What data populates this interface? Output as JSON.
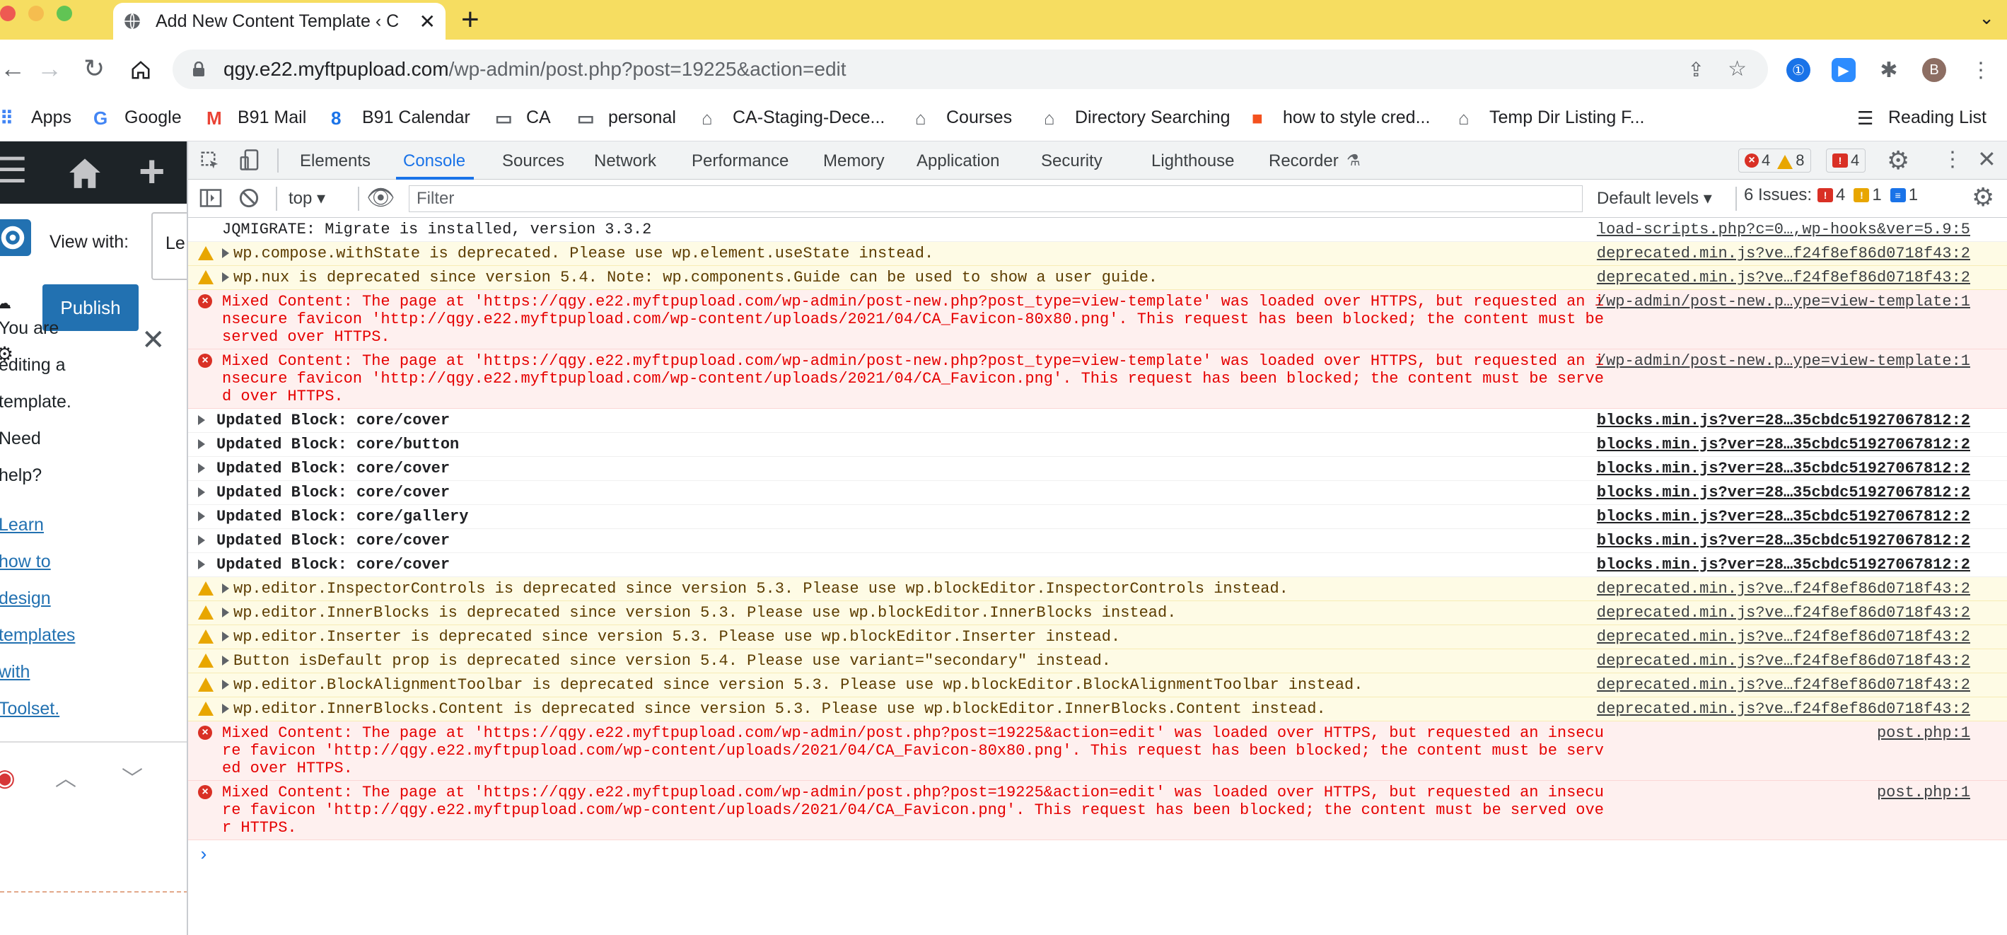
{
  "colors": {
    "tabstrip": "#f6dd61",
    "wp_blue": "#2271b1",
    "wp_dark": "#1d2327",
    "error": "#d93025",
    "warning": "#e8a600",
    "accent": "#1a73e8"
  },
  "browser": {
    "tab_title": "Add New Content Template ‹ C",
    "url_host": "qgy.e22.myftpupload.com",
    "url_path": "/wp-admin/post.php?post=19225&action=edit",
    "profile_initial": "B"
  },
  "bookmarks": [
    {
      "label": "Apps",
      "icon": "apps-grid-icon"
    },
    {
      "label": "Google",
      "icon": "google-icon"
    },
    {
      "label": "B91 Mail",
      "icon": "gmail-icon"
    },
    {
      "label": "B91 Calendar",
      "icon": "calendar-icon"
    },
    {
      "label": "CA",
      "icon": "folder-icon"
    },
    {
      "label": "personal",
      "icon": "folder-icon"
    },
    {
      "label": "CA-Staging-Dece...",
      "icon": "bell-icon"
    },
    {
      "label": "Courses",
      "icon": "bell-icon"
    },
    {
      "label": "Directory Searching",
      "icon": "bell-icon"
    },
    {
      "label": "how to style cred...",
      "icon": "orange-app-icon"
    },
    {
      "label": "Temp Dir Listing F...",
      "icon": "bell-icon"
    }
  ],
  "reading_list": "Reading List",
  "wp": {
    "view_with": "View with:",
    "select_value": "Le",
    "publish": "Publish",
    "lines": [
      "You are",
      "editing a",
      "template.",
      "Need",
      "help?"
    ],
    "links": [
      "Learn",
      "how to",
      "design",
      "templates",
      "with",
      "Toolset."
    ]
  },
  "devtools": {
    "tabs": [
      "Elements",
      "Console",
      "Sources",
      "Network",
      "Performance",
      "Memory",
      "Application",
      "Security",
      "Lighthouse",
      "Recorder"
    ],
    "active_tab": "Console",
    "badges": {
      "errors": "4",
      "warnings": "8",
      "issues": "4"
    },
    "context": "top",
    "filter_placeholder": "Filter",
    "levels": "Default levels",
    "issues_label": "6 Issues:",
    "issues_counts": {
      "errors": "4",
      "warnings": "1",
      "info": "1"
    },
    "prompt": "›"
  },
  "console": [
    {
      "level": "info",
      "msg": "JQMIGRATE: Migrate is installed, version 3.3.2",
      "src": "load-scripts.php?c=0…,wp-hooks&ver=5.9:5",
      "caret": false,
      "bold": false
    },
    {
      "level": "warn",
      "msg": "wp.compose.withState is deprecated. Please use wp.element.useState instead.",
      "src": "deprecated.min.js?ve…f24f8ef86d0718f43:2",
      "caret": true,
      "bold": false
    },
    {
      "level": "warn",
      "msg": "wp.nux is deprecated since version 5.4. Note: wp.components.Guide can be used to show a user guide.",
      "src": "deprecated.min.js?ve…f24f8ef86d0718f43:2",
      "caret": true,
      "bold": false
    },
    {
      "level": "err",
      "msg": "Mixed Content: The page at 'https://qgy.e22.myftpupload.com/wp-admin/post-new.php?post_type=view-template' was loaded over HTTPS, but requested an insecure favicon 'http://qgy.e22.myftpupload.com/wp-content/uploads/2021/04/CA_Favicon-80x80.png'. This request has been blocked; the content must be served over HTTPS.",
      "src": "/wp-admin/post-new.p…ype=view-template:1",
      "caret": false,
      "bold": false
    },
    {
      "level": "err",
      "msg": "Mixed Content: The page at 'https://qgy.e22.myftpupload.com/wp-admin/post-new.php?post_type=view-template' was loaded over HTTPS, but requested an insecure favicon 'http://qgy.e22.myftpupload.com/wp-content/uploads/2021/04/CA_Favicon.png'. This request has been blocked; the content must be served over HTTPS.",
      "src": "/wp-admin/post-new.p…ype=view-template:1",
      "caret": false,
      "bold": false
    },
    {
      "level": "info",
      "msg": "Updated Block: core/cover",
      "src": "blocks.min.js?ver=28…35cbdc51927067812:2",
      "caret": true,
      "bold": true
    },
    {
      "level": "info",
      "msg": "Updated Block: core/button",
      "src": "blocks.min.js?ver=28…35cbdc51927067812:2",
      "caret": true,
      "bold": true
    },
    {
      "level": "info",
      "msg": "Updated Block: core/cover",
      "src": "blocks.min.js?ver=28…35cbdc51927067812:2",
      "caret": true,
      "bold": true
    },
    {
      "level": "info",
      "msg": "Updated Block: core/cover",
      "src": "blocks.min.js?ver=28…35cbdc51927067812:2",
      "caret": true,
      "bold": true
    },
    {
      "level": "info",
      "msg": "Updated Block: core/gallery",
      "src": "blocks.min.js?ver=28…35cbdc51927067812:2",
      "caret": true,
      "bold": true
    },
    {
      "level": "info",
      "msg": "Updated Block: core/cover",
      "src": "blocks.min.js?ver=28…35cbdc51927067812:2",
      "caret": true,
      "bold": true
    },
    {
      "level": "info",
      "msg": "Updated Block: core/cover",
      "src": "blocks.min.js?ver=28…35cbdc51927067812:2",
      "caret": true,
      "bold": true
    },
    {
      "level": "warn",
      "msg": "wp.editor.InspectorControls is deprecated since version 5.3. Please use wp.blockEditor.InspectorControls instead.",
      "src": "deprecated.min.js?ve…f24f8ef86d0718f43:2",
      "caret": true,
      "bold": false
    },
    {
      "level": "warn",
      "msg": "wp.editor.InnerBlocks is deprecated since version 5.3. Please use wp.blockEditor.InnerBlocks instead.",
      "src": "deprecated.min.js?ve…f24f8ef86d0718f43:2",
      "caret": true,
      "bold": false
    },
    {
      "level": "warn",
      "msg": "wp.editor.Inserter is deprecated since version 5.3. Please use wp.blockEditor.Inserter instead.",
      "src": "deprecated.min.js?ve…f24f8ef86d0718f43:2",
      "caret": true,
      "bold": false
    },
    {
      "level": "warn",
      "msg": "Button isDefault prop is deprecated since version 5.4. Please use variant=\"secondary\" instead.",
      "src": "deprecated.min.js?ve…f24f8ef86d0718f43:2",
      "caret": true,
      "bold": false
    },
    {
      "level": "warn",
      "msg": "wp.editor.BlockAlignmentToolbar is deprecated since version 5.3. Please use wp.blockEditor.BlockAlignmentToolbar instead.",
      "src": "deprecated.min.js?ve…f24f8ef86d0718f43:2",
      "caret": true,
      "bold": false
    },
    {
      "level": "warn",
      "msg": "wp.editor.InnerBlocks.Content is deprecated since version 5.3. Please use wp.blockEditor.InnerBlocks.Content instead.",
      "src": "deprecated.min.js?ve…f24f8ef86d0718f43:2",
      "caret": true,
      "bold": false
    },
    {
      "level": "err",
      "msg": "Mixed Content: The page at 'https://qgy.e22.myftpupload.com/wp-admin/post.php?post=19225&action=edit' was loaded over HTTPS, but requested an insecure favicon 'http://qgy.e22.myftpupload.com/wp-content/uploads/2021/04/CA_Favicon-80x80.png'. This request has been blocked; the content must be served over HTTPS.",
      "src": "post.php:1",
      "caret": false,
      "bold": false
    },
    {
      "level": "err",
      "msg": "Mixed Content: The page at 'https://qgy.e22.myftpupload.com/wp-admin/post.php?post=19225&action=edit' was loaded over HTTPS, but requested an insecure favicon 'http://qgy.e22.myftpupload.com/wp-content/uploads/2021/04/CA_Favicon.png'. This request has been blocked; the content must be served over HTTPS.",
      "src": "post.php:1",
      "caret": false,
      "bold": false
    }
  ]
}
